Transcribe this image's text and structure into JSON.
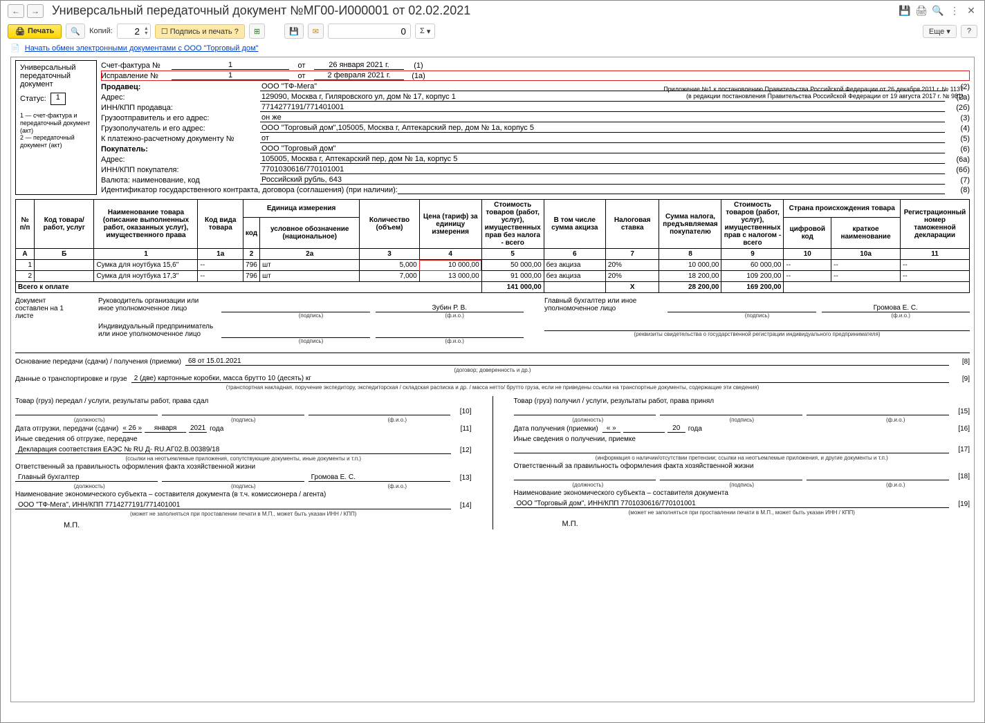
{
  "window": {
    "title": "Универсальный передаточный документ №МГ00-И000001 от 02.02.2021",
    "more": "Еще",
    "help": "?"
  },
  "toolbar": {
    "print": "Печать",
    "copies_label": "Копий:",
    "copies_value": "2",
    "sign_and_stamp": "Подпись и печать ?",
    "num_value": "0",
    "sigma": "Σ"
  },
  "link": {
    "text": "Начать обмен электронными документами с ООО \"Торговый дом\""
  },
  "docType": {
    "line1": "Универсальный",
    "line2": "передаточный",
    "line3": "документ",
    "status_label": "Статус:",
    "status_value": "1",
    "legend": "1 — счет-фактура и передаточный документ (акт)\n2 — передаточный документ (акт)"
  },
  "sf": {
    "label1": "Счет-фактура №",
    "no1": "1",
    "ot": "от",
    "date1": "26 января 2021 г.",
    "suf1": "(1)",
    "label2": "Исправление №",
    "no2": "1",
    "date2": "2 февраля 2021 г.",
    "suf2": "(1а)"
  },
  "appendix": {
    "l1": "Приложение №1 к постановлению Правительства Российской Федерации от 26 декабря 2011 г. № 1137",
    "l2": "(в редакции постановления Правительства Российской Федерации от 19 августа 2017 г. № 981)"
  },
  "info": [
    {
      "label": "Продавец:",
      "bold": true,
      "value": "ООО \"ТФ-Мега\"",
      "code": "(2)"
    },
    {
      "label": "Адрес:",
      "value": "129090, Москва г, Гиляровского ул, дом № 17, корпус 1",
      "code": "(2а)"
    },
    {
      "label": "ИНН/КПП продавца:",
      "value": "7714277191/771401001",
      "code": "(2б)"
    },
    {
      "label": "Грузоотправитель и его адрес:",
      "value": "он же",
      "code": "(3)"
    },
    {
      "label": "Грузополучатель и его адрес:",
      "value": "ООО \"Торговый дом\",105005, Москва г, Аптекарский пер, дом № 1а, корпус 5",
      "code": "(4)"
    },
    {
      "label": "К платежно-расчетному документу №",
      "value": "               от",
      "code": "(5)"
    },
    {
      "label": "Покупатель:",
      "bold": true,
      "value": "ООО \"Торговый дом\"",
      "code": "(6)"
    },
    {
      "label": "Адрес:",
      "value": "105005, Москва г, Аптекарский пер, дом № 1а, корпус 5",
      "code": "(6а)"
    },
    {
      "label": "ИНН/КПП покупателя:",
      "value": "7701030616/770101001",
      "code": "(6б)"
    },
    {
      "label": "Валюта: наименование, код",
      "value": "Российский рубль, 643",
      "code": "(7)"
    },
    {
      "label": "Идентификатор государственного контракта, договора (соглашения) (при наличии):",
      "value": "",
      "code": "(8)",
      "nowrap": true
    }
  ],
  "table": {
    "headers": {
      "npp": "№ п/п",
      "code": "Код товара/ работ, услуг",
      "name": "Наименование товара (описание выполненных работ, оказанных услуг), имущественного права",
      "vid": "Код вида товара",
      "unit": "Единица измерения",
      "unit_code": "код",
      "unit_name": "условное обозначение (национальное)",
      "qty": "Количество (объем)",
      "price": "Цена (тариф) за единицу измерения",
      "cost": "Стоимость товаров (работ, услуг), имущественных прав без налога - всего",
      "excise": "В том числе сумма акциза",
      "rate": "Налоговая ставка",
      "tax": "Сумма налога, предъявляемая покупателю",
      "total": "Стоимость товаров (работ, услуг), имущественных прав с налогом - всего",
      "country": "Страна происхождения товара",
      "country_code": "цифровой код",
      "country_name": "краткое наименование",
      "decl": "Регистрационный номер таможенной декларации"
    },
    "idx": {
      "a": "А",
      "b": "Б",
      "c1": "1",
      "c1a": "1а",
      "c2": "2",
      "c2a": "2а",
      "c3": "3",
      "c4": "4",
      "c5": "5",
      "c6": "6",
      "c7": "7",
      "c8": "8",
      "c9": "9",
      "c10": "10",
      "c10a": "10а",
      "c11": "11"
    },
    "rows": [
      {
        "n": "1",
        "code": "",
        "name": "Сумка для ноутбука 15,6\"",
        "vid": "--",
        "uc": "796",
        "un": "шт",
        "qty": "5,000",
        "price": "10 000,00",
        "cost": "50 000,00",
        "excise": "без акциза",
        "rate": "20%",
        "tax": "10 000,00",
        "total": "60 000,00",
        "cc": "--",
        "cn": "--",
        "decl": "--",
        "price_red": true
      },
      {
        "n": "2",
        "code": "",
        "name": "Сумка для ноутбука 17,3\"",
        "vid": "--",
        "uc": "796",
        "un": "шт",
        "qty": "7,000",
        "price": "13 000,00",
        "cost": "91 000,00",
        "excise": "без акциза",
        "rate": "20%",
        "tax": "18 200,00",
        "total": "109 200,00",
        "cc": "--",
        "cn": "--",
        "decl": "--"
      }
    ],
    "totals": {
      "label": "Всего к оплате",
      "cost": "141 000,00",
      "x": "X",
      "tax": "28 200,00",
      "total": "169 200,00"
    }
  },
  "sign": {
    "compiled": "Документ составлен на 1 листе",
    "head": "Руководитель организации или иное уполномоченное лицо",
    "head_name": "Зубин Р. В.",
    "accountant": "Главный бухгалтер или иное уполномоченное лицо",
    "acc_name": "Громова Е. С.",
    "ip": "Индивидуальный предприниматель или иное уполномоченное лицо",
    "sub_sign": "(подпись)",
    "sub_fio": "(ф.и.о.)",
    "ip_note": "(реквизиты свидетельства о государственной регистрации индивидуального предпринимателя)"
  },
  "lower": {
    "basis_label": "Основание передачи (сдачи) / получения (приемки)",
    "basis_val": "68 от 15.01.2021",
    "basis_code": "[8]",
    "basis_sub": "(договор; доверенность и др.)",
    "trans_label": "Данные о транспортировке и грузе",
    "trans_val": "2 (две) картонные коробки, масса брутто 10 (десять) кг",
    "trans_code": "[9]",
    "trans_sub": "(транспортная накладная, поручение экспедитору, экспедиторская / складская расписка и др. / масса нетто/ брутто груза, если не приведены ссылки на транспортные документы, содержащие эти сведения)"
  },
  "left": {
    "l1": "Товар (груз) передал / услуги, результаты работ, права сдал",
    "c1": "[10]",
    "date_label": "Дата отгрузки, передачи (сдачи)",
    "dd": "« 26 »",
    "dm": "января",
    "dy": "2021",
    "dyear": "года",
    "dcode": "[11]",
    "other_label": "Иные сведения об отгрузке, передаче",
    "decl": "Декларация соответствия ЕАЭС № RU Д- RU.АГ02.В.00389/18",
    "decl_code": "[12]",
    "decl_sub": "(ссылки на неотъемлемые приложения, сопутствующие документы, иные документы и т.п.)",
    "resp": "Ответственный за правильность оформления факта хозяйственной жизни",
    "resp_pos": "Главный бухгалтер",
    "resp_name": "Громова Е. С.",
    "resp_code": "[13]",
    "econ": "Наименование экономического субъекта – составителя документа (в т.ч. комиссионера / агента)",
    "econ_val": "ООО \"ТФ-Мега\", ИНН/КПП 7714277191/771401001",
    "econ_code": "[14]",
    "econ_sub": "(может не заполняться при проставлении печати в М.П., может быть указан ИНН / КПП)",
    "mp": "М.П."
  },
  "right": {
    "l1": "Товар (груз) получил / услуги, результаты работ, права принял",
    "c1": "[15]",
    "date_label": "Дата получения (приемки)",
    "dd": "«     »",
    "dm": "",
    "dy": "20",
    "dyear": "года",
    "dcode": "[16]",
    "other_label": "Иные сведения о получении, приемке",
    "decl": "",
    "decl_code": "[17]",
    "decl_sub": "(информация о наличии/отсутствии претензии; ссылки на неотъемлемые приложения, и другие документы и т.п.)",
    "resp": "Ответственный за правильность оформления факта хозяйственной жизни",
    "resp_pos": "",
    "resp_name": "",
    "resp_code": "[18]",
    "econ": "Наименование экономического субъекта – составителя документа",
    "econ_val": "ООО \"Торговый дом\", ИНН/КПП 7701030616/770101001",
    "econ_code": "[19]",
    "econ_sub": "(может не заполняться при проставлении печати в М.П., может быть указан ИНН / КПП)",
    "mp": "М.П."
  },
  "subs": {
    "pos": "(должность)",
    "sign": "(подпись)",
    "fio": "(ф.и.о.)"
  }
}
